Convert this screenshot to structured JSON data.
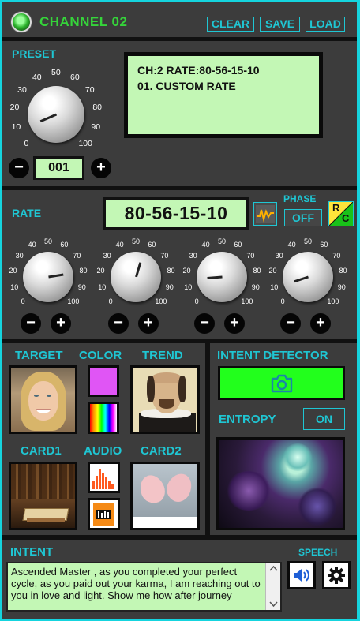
{
  "header": {
    "title": "CHANNEL 02",
    "buttons": {
      "clear": "CLEAR",
      "save": "SAVE",
      "load": "LOAD"
    }
  },
  "preset": {
    "label": "PRESET",
    "lcd_line1": "CH:2  RATE:80-56-15-10",
    "lcd_line2": "01. CUSTOM RATE",
    "number": "001",
    "knob_value": 8,
    "minus": "−",
    "plus": "+"
  },
  "rate": {
    "label": "RATE",
    "value": "80-56-15-10",
    "phase_label": "PHASE",
    "phase_value": "OFF",
    "rc_label_r": "R",
    "rc_label_c": "C",
    "knob_values": [
      80,
      56,
      15,
      10
    ],
    "minus": "−",
    "plus": "+"
  },
  "scale_labels": [
    "0",
    "10",
    "20",
    "30",
    "40",
    "50",
    "60",
    "70",
    "80",
    "90",
    "100"
  ],
  "icons": {
    "waveform": "waveform-icon",
    "rc": "rc-icon",
    "camera": "camera-icon",
    "speaker": "speaker-icon",
    "gear": "gear-icon",
    "spectrum": "spectrum-icon",
    "audio_file": "audio-file-icon"
  },
  "panel": {
    "target": "TARGET",
    "color": "COLOR",
    "trend": "TREND",
    "card1": "CARD1",
    "audio": "AUDIO",
    "card2": "CARD2",
    "color_swatch": "#e055f5"
  },
  "detector": {
    "label": "INTENT DETECTOR",
    "entropy_label": "ENTROPY",
    "entropy_state": "ON",
    "detector_color": "#22ff1c"
  },
  "intent": {
    "label": "INTENT",
    "speech_label": "SPEECH",
    "text": "Ascended Master , as you completed your perfect cycle, as you paid out your karma, I am reaching out to you in love and light. Show me how after journey"
  },
  "theme": {
    "accent": "#1fc6d3",
    "panel_bg": "#3c3c3c",
    "lcd_bg": "#c3f7b5",
    "title_green": "#35d43a"
  }
}
